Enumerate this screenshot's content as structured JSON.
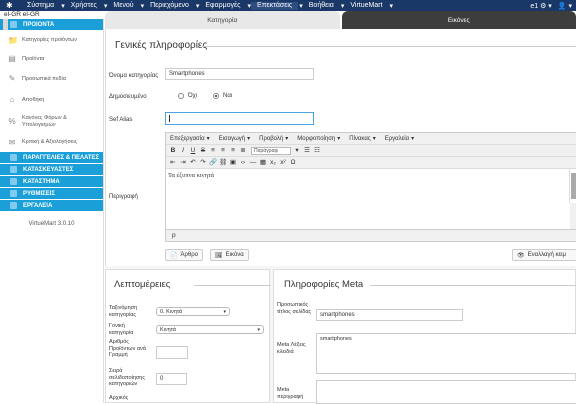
{
  "topbar": {
    "menu": [
      "Σύστημα",
      "Χρήστες",
      "Μενού",
      "Περιεχόμενο",
      "Εφαρμογές",
      "Επεκτάσεις",
      "Βοήθεια",
      "VirtueMart"
    ],
    "active_index": 5,
    "user": "e1",
    "caret": "▾"
  },
  "lang": "el-GR el-GR",
  "tabs": [
    "Κατηγορία",
    "Εικόνες"
  ],
  "sidebar": {
    "sections": [
      {
        "label": "ΠΡΟΙΟΝΤΑ",
        "items": [
          {
            "label": "Κατηγορίες προϊόντων",
            "icon": "folder-icon"
          },
          {
            "label": "Προϊόντα",
            "icon": "box-icon"
          },
          {
            "label": "Προσωπικά πεδία",
            "icon": "tag-icon"
          },
          {
            "label": "Αποθήκη",
            "icon": "warehouse-icon"
          },
          {
            "label": "Κανόνες Φόρων & Υπολογισμών",
            "icon": "percent-icon"
          },
          {
            "label": "Κριτική & Αξιολογήσεις",
            "icon": "comment-icon"
          }
        ]
      },
      {
        "label": "ΠΑΡΑΓΓΕΛΙΕΣ & ΠΕΛΑΤΕΣ",
        "items": []
      },
      {
        "label": "ΚΑΤΑΣΚΕΥΑΣΤΕΣ",
        "items": []
      },
      {
        "label": "ΚΑΤΑΣΤΗΜΑ",
        "items": []
      },
      {
        "label": "ΡΥΘΜΙΣΕΙΣ",
        "items": []
      },
      {
        "label": "ΕΡΓΑΛΕΙΑ",
        "items": []
      }
    ],
    "version": "VirtueMart 3.0.10"
  },
  "general": {
    "title": "Γενικές πληροφορίες",
    "name_label": "Όνομα κατηγορίας",
    "name_value": "Smartphones",
    "published_label": "Δημοσιευμένο",
    "no_label": "Όχι",
    "yes_label": "Ναι",
    "alias_label": "Sef Alias",
    "alias_value": "",
    "desc_label": "Περιγραφή"
  },
  "editor": {
    "menus": [
      "Επεξεργασία",
      "Εισαγωγή",
      "Προβολή",
      "Μορφοποίηση",
      "Πίνακας",
      "Εργαλεία"
    ],
    "format_select": "Παράγραφ",
    "content": "Τα έξυπνα κινητά",
    "status": "p",
    "btn_article": "Άρθρο",
    "btn_image": "Εικόνα",
    "btn_toggle": "Εναλλαγή κειμ"
  },
  "details": {
    "title": "Λεπτομέρειες",
    "order_label": "Ταξινόμηση κατηγορίας",
    "order_value": "0. Κινητά",
    "parent_label": "Γονική κατηγορία",
    "parent_value": "Κινητά",
    "per_row_label": "Αριθμός Προϊόντων ανά Γραμμή",
    "per_row_value": "",
    "page_order_label": "Σειρά σελιδοποίησης κατηγοριών",
    "page_order_value": "0",
    "initial_label": "Αρχικός"
  },
  "meta": {
    "title": "Πληροφορίες Meta",
    "custom_title_label": "Προσωπικός τίτλος σελίδας",
    "custom_title_value": "smartphones",
    "keywords_label": "Meta Λέξεις κλειδιά",
    "keywords_value": "smartphones",
    "desc_label": "Meta περιγραφή"
  }
}
